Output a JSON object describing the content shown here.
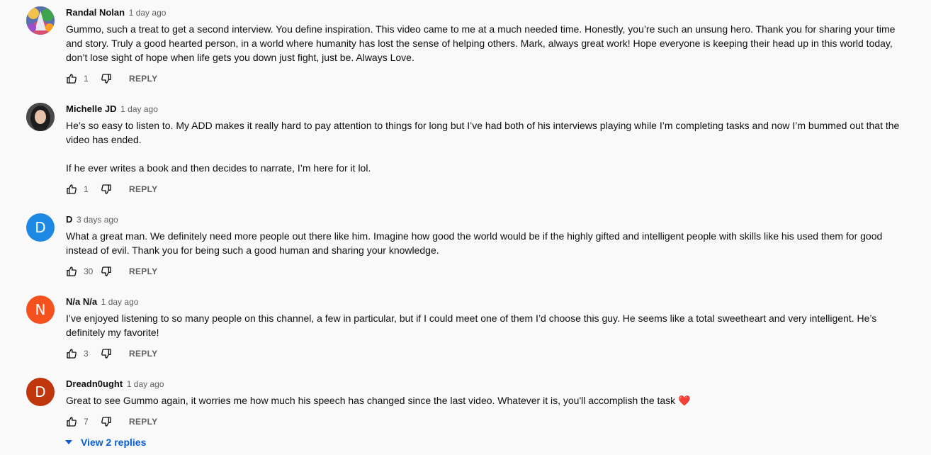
{
  "comments": [
    {
      "author": "Randal Nolan",
      "time": "1 day ago",
      "avatar": {
        "type": "image",
        "icon": "user-photo-colorful"
      },
      "paragraphs": [
        "Gummo, such a treat to get a second interview. You define inspiration. This video came to me at a much needed time. Honestly, you’re such an unsung hero. Thank you for sharing your time and story. Truly a good hearted person, in a world where humanity has lost the sense of helping others. Mark, always great work! Hope everyone is keeping their head up in this world today, don’t lose sight of hope when life gets you down just fight, just be. Always Love."
      ],
      "likes": "1",
      "reply_label": "REPLY"
    },
    {
      "author": "Michelle JD",
      "time": "1 day ago",
      "avatar": {
        "type": "image",
        "icon": "user-photo-portrait"
      },
      "paragraphs": [
        "He’s so easy to listen to. My ADD makes it really hard to pay attention to things for long but I’ve had both of his interviews playing while I’m completing tasks and now I’m bummed out that the video has ended.",
        "If he ever writes a book and then decides to narrate, I’m here for it lol."
      ],
      "likes": "1",
      "reply_label": "REPLY"
    },
    {
      "author": "D",
      "time": "3 days ago",
      "avatar": {
        "type": "letter",
        "letter": "D",
        "color": "#1e88e5"
      },
      "paragraphs": [
        "What a great man. We definitely need more people out there like him. Imagine how good the world would be if the highly gifted and intelligent people with skills like his used them for good instead of evil. Thank you for being such a good human and sharing your knowledge."
      ],
      "likes": "30",
      "reply_label": "REPLY"
    },
    {
      "author": "N/a N/a",
      "time": "1 day ago",
      "avatar": {
        "type": "letter",
        "letter": "N",
        "color": "#f4511e"
      },
      "paragraphs": [
        "I’ve enjoyed listening to so many people on this channel, a few in particular, but if I could meet one of them I’d choose this guy. He seems like a total sweetheart and very intelligent. He’s definitely my favorite!"
      ],
      "likes": "3",
      "reply_label": "REPLY"
    },
    {
      "author": "Dreadn0ught",
      "time": "1 day ago",
      "avatar": {
        "type": "letter",
        "letter": "D",
        "color": "#bf360c"
      },
      "paragraphs": [
        "Great to see Gummo again, it worries me how much his speech has changed since the last video. Whatever it is, you'll accomplish the task"
      ],
      "emoji": "❤️",
      "likes": "7",
      "reply_label": "REPLY"
    }
  ],
  "view_replies_label": "View 2 replies"
}
